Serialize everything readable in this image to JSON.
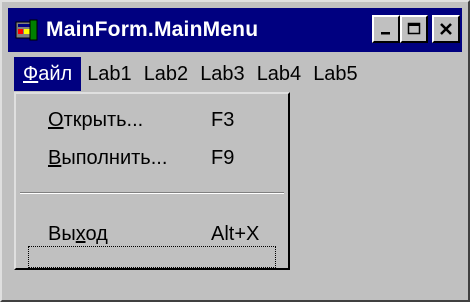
{
  "window": {
    "title": "MainForm.MainMenu",
    "icon": "app-form-icon",
    "controls": [
      "minimize-icon",
      "maximize-icon",
      "close-icon"
    ]
  },
  "menubar": {
    "items": [
      {
        "first": "Ф",
        "rest": "айл"
      },
      {
        "label": "Lab1"
      },
      {
        "label": "Lab2"
      },
      {
        "label": "Lab3"
      },
      {
        "label": "Lab4"
      },
      {
        "label": "Lab5"
      }
    ]
  },
  "dropdown": {
    "items": [
      {
        "first": "О",
        "rest": "ткрыть...",
        "shortcut": "F3"
      },
      {
        "first": "В",
        "rest": "ыполнить...",
        "shortcut": "F9"
      },
      {
        "pre": "Вы",
        "ul": "х",
        "post": "од",
        "shortcut": "Alt+X"
      }
    ]
  },
  "colors": {
    "title_bar": "#000080",
    "face": "#c0c0c0",
    "highlight_text": "#ffffff"
  }
}
